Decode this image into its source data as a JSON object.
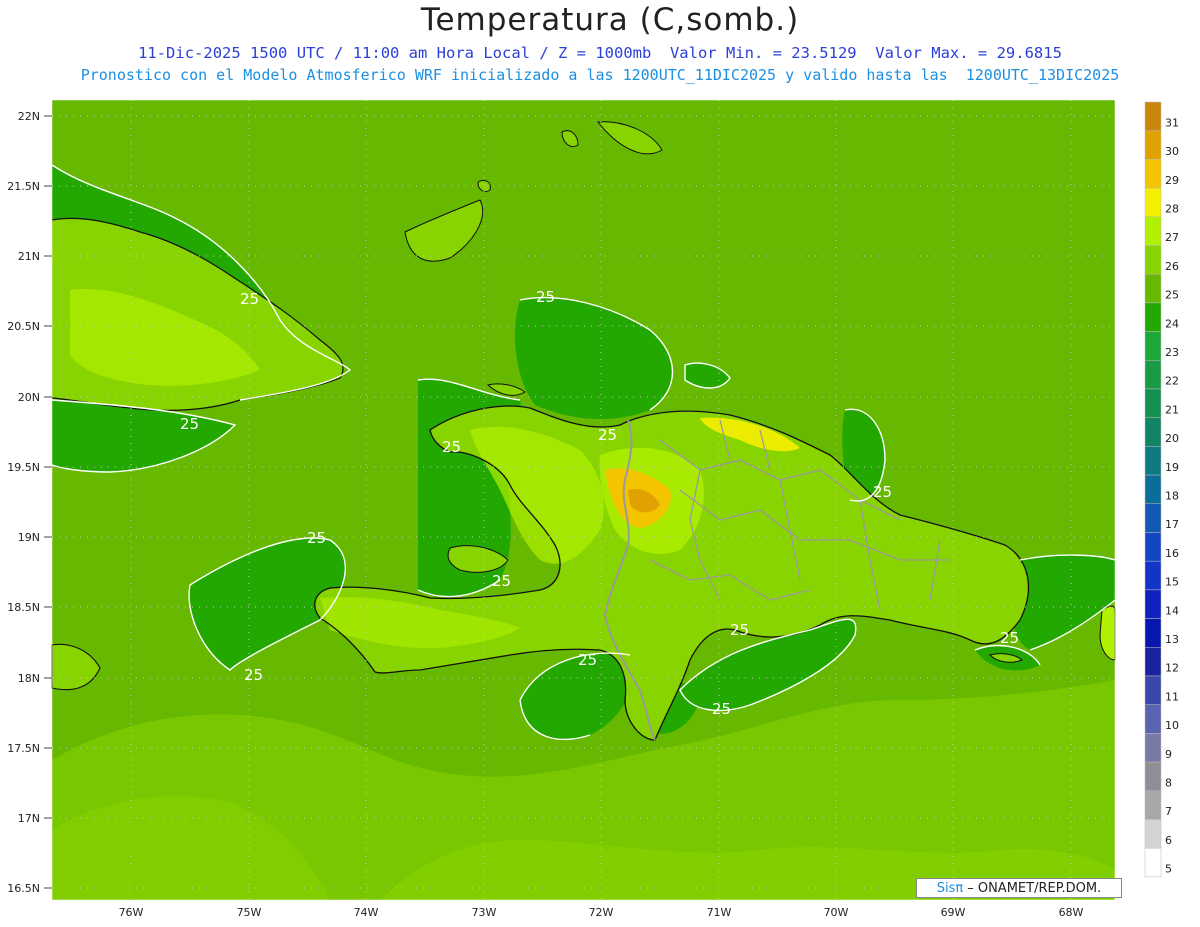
{
  "header": {
    "title": "Temperatura (C,somb.)",
    "line1": "11-Dic-2025 1500 UTC / 11:00 am Hora Local / Z = 1000mb  Valor Min. = 23.5129  Valor Max. = 29.6815",
    "line2": "Pronostico con el Modelo Atmosferico WRF inicializado a las 1200UTC_11DIC2025 y valido hasta las  1200UTC_13DIC2025"
  },
  "axes": {
    "lat_labels": [
      "22N",
      "21.5N",
      "21N",
      "20.5N",
      "20N",
      "19.5N",
      "19N",
      "18.5N",
      "18N",
      "17.5N",
      "17N",
      "16.5N"
    ],
    "lon_labels": [
      "76W",
      "75W",
      "74W",
      "73W",
      "72W",
      "71W",
      "70W",
      "69W",
      "68W"
    ]
  },
  "colorbar": {
    "labels": [
      "31",
      "30",
      "29",
      "28",
      "27",
      "26",
      "25",
      "24",
      "23",
      "22",
      "21",
      "20",
      "19",
      "18",
      "17",
      "16",
      "15",
      "14",
      "13",
      "12",
      "11",
      "10",
      "9",
      "8",
      "7",
      "6",
      "5"
    ],
    "colors": [
      "#c8860a",
      "#e0a200",
      "#f4c400",
      "#f6ee00",
      "#b0f000",
      "#88d400",
      "#66b800",
      "#22a800",
      "#1ea83a",
      "#1a9a44",
      "#169052",
      "#128466",
      "#0e7a80",
      "#0c6c9a",
      "#1258b4",
      "#1446c4",
      "#1234c8",
      "#0e22c0",
      "#0818ae",
      "#1a22a0",
      "#3a46a8",
      "#5a64b0",
      "#7a7aa8",
      "#8e8e96",
      "#a8a8a8",
      "#d4d4d4",
      "#ffffff"
    ]
  },
  "contours": {
    "label": "25"
  },
  "credit": {
    "brand": "Sisπ",
    "text": "– ONAMET/REP.DOM."
  }
}
